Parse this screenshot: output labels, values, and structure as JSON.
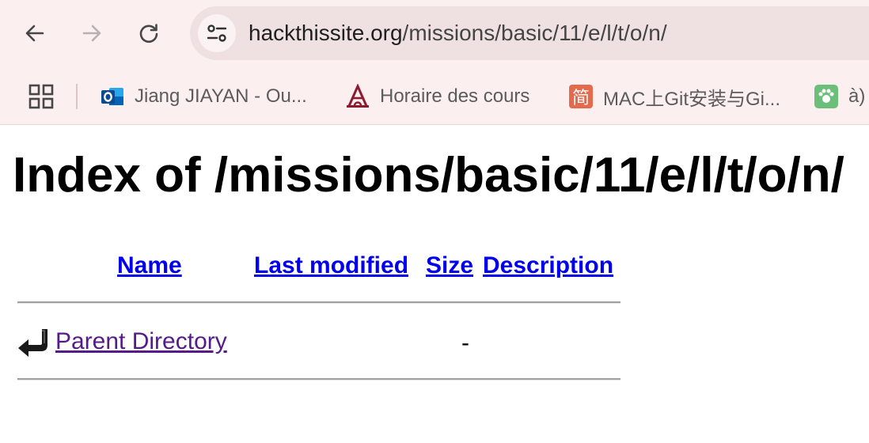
{
  "browser": {
    "url_host": "hackthissite.org",
    "url_path": "/missions/basic/11/e/l/t/o/n/",
    "bookmarks": [
      {
        "label": "Jiang JIAYAN - Ou...",
        "icon": "outlook-icon"
      },
      {
        "label": "Horaire des cours",
        "icon": "university-logo-icon"
      },
      {
        "label": "MAC上Git安装与Gi...",
        "icon": "jianshu-icon",
        "icon_text": "简"
      },
      {
        "label": "à)",
        "icon": "green-app-icon"
      }
    ]
  },
  "page": {
    "title": "Index of /missions/basic/11/e/l/t/o/n/",
    "columns": {
      "name": "Name",
      "last_modified": "Last modified",
      "size": "Size",
      "description": "Description"
    },
    "rows": [
      {
        "name": "Parent Directory",
        "last_modified": "",
        "size": "-",
        "description": "",
        "icon": "back-arrow-icon"
      }
    ]
  },
  "colors": {
    "chrome_bg": "#fcefef",
    "omnibox_bg": "#efe1e2",
    "link": "#0000ee",
    "visited_link": "#551a8b"
  }
}
